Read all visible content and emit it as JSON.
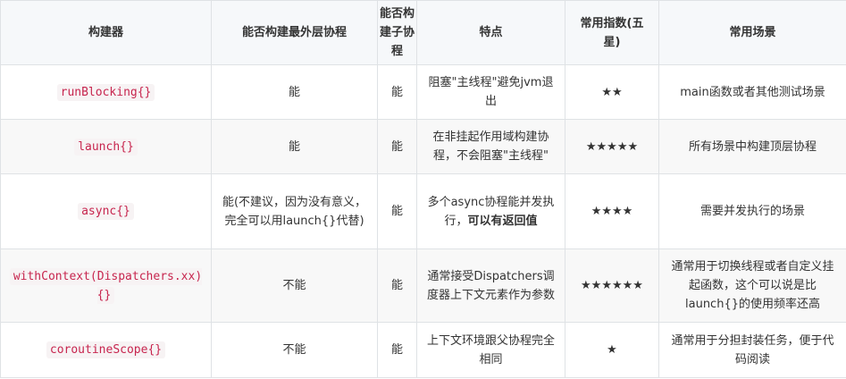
{
  "table": {
    "headers": [
      "构建器",
      "能否构建最外层协程",
      "能否构建子协程",
      "特点",
      "常用指数(五星)",
      "常用场景"
    ],
    "rows": [
      {
        "builder": "runBlocking{}",
        "outermost": "能",
        "child": "能",
        "feature": "阻塞\"主线程\"避免jvm退出",
        "feature_bold": "",
        "stars": "★★",
        "scenario": "main函数或者其他测试场景"
      },
      {
        "builder": "launch{}",
        "outermost": "能",
        "child": "能",
        "feature": "在非挂起作用域构建协程，不会阻塞\"主线程\"",
        "feature_bold": "",
        "stars": "★★★★★",
        "scenario": "所有场景中构建顶层协程"
      },
      {
        "builder": "async{}",
        "outermost": "能(不建议，因为没有意义，完全可以用launch{}代替)",
        "child": "能",
        "feature": "多个async协程能并发执行，",
        "feature_bold": "可以有返回值",
        "stars": "★★★★",
        "scenario": "需要并发执行的场景"
      },
      {
        "builder": "withContext(Dispatchers.xx){}",
        "outermost": "不能",
        "child": "能",
        "feature": "通常接受Dispatchers调度器上下文元素作为参数",
        "feature_bold": "",
        "stars": "★★★★★★",
        "scenario": "通常用于切换线程或者自定义挂起函数，这个可以说是比launch{}的使用频率还高"
      },
      {
        "builder": "coroutineScope{}",
        "outermost": "不能",
        "child": "能",
        "feature": "上下文环境跟父协程完全相同",
        "feature_bold": "",
        "stars": "★",
        "scenario": "通常用于分担封装任务，便于代码阅读"
      }
    ]
  }
}
